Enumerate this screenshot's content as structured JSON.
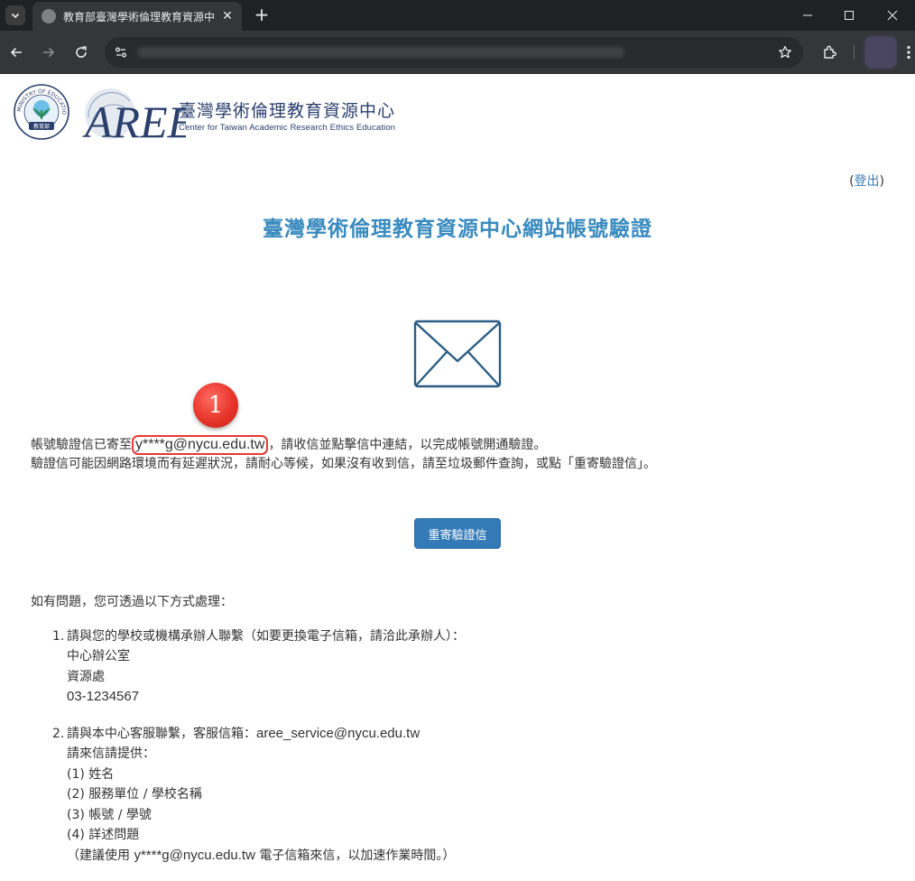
{
  "browser": {
    "tab_title": "教育部臺灣學術倫理教育資源中",
    "tab_close": "✕",
    "new_tab": "+",
    "icons": [
      "tab-list-icon",
      "globe-icon",
      "close-icon",
      "minimize-icon",
      "maximize-icon",
      "back-icon",
      "forward-icon",
      "reload-icon",
      "site-info-icon",
      "star-icon",
      "extensions-icon",
      "kebab-menu-icon"
    ]
  },
  "header": {
    "org_name_cn": "臺灣學術倫理教育資源中心",
    "org_name_en": "Center for Taiwan Academic Research Ethics Education",
    "logo_text": "AREE",
    "seal_text": "MINISTRY OF EDUCATION",
    "seal_cn": "教育部"
  },
  "logout": {
    "open_paren": "(",
    "label": "登出",
    "close_paren": ")"
  },
  "title": "臺灣學術倫理教育資源中心網站帳號驗證",
  "annotation_badge": "1",
  "message": {
    "line1_prefix": "帳號驗證信已寄至",
    "email": "y****g@nycu.edu.tw",
    "line1_suffix": "，請收信並點擊信中連結，以完成帳號開通驗證。",
    "line2": "驗證信可能因網路環境而有延遲狀況，請耐心等候，如果沒有收到信，請至垃圾郵件查詢，或點「重寄驗證信」。"
  },
  "resend_button": "重寄驗證信",
  "help": {
    "intro": "如有問題，您可透過以下方式處理：",
    "item1": {
      "num": "1.",
      "heading": "請與您的學校或機構承辦人聯繫（如要更換電子信箱，請洽此承辦人）：",
      "lines": [
        "中心辦公室",
        "資源處",
        "03-1234567"
      ]
    },
    "item2": {
      "num": "2.",
      "heading_prefix": "請與本中心客服聯繫，客服信箱：",
      "service_email": "aree_service@nycu.edu.tw",
      "provide": "請來信請提供：",
      "fields": [
        "(1) 姓名",
        "(2) 服務單位 / 學校名稱",
        "(3) 帳號 / 學號",
        "(4) 詳述問題"
      ],
      "note_prefix": "（建議使用 ",
      "note_email": "y****g@nycu.edu.tw",
      "note_suffix": " 電子信箱來信，以加速作業時間。）"
    }
  },
  "colors": {
    "title": "#3a8bbf",
    "button": "#337ab7",
    "highlight": "#e53935",
    "logo_navy": "#2a3f6c"
  }
}
